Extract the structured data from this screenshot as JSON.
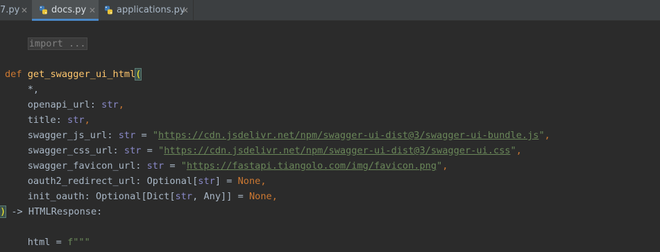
{
  "tabs": [
    {
      "label": "7.py",
      "active": false
    },
    {
      "label": "docs.py",
      "active": true
    },
    {
      "label": "applications.py",
      "active": false
    }
  ],
  "editor": {
    "fold": "import ...",
    "def_kw": "def",
    "fn_name": "get_swagger_ui_html",
    "open_paren": "(",
    "star": "*,",
    "params": [
      {
        "name": "openapi_url",
        "type": "str"
      },
      {
        "name": "title",
        "type": "str"
      },
      {
        "name": "swagger_js_url",
        "type": "str",
        "url": "https://cdn.jsdelivr.net/npm/swagger-ui-dist@3/swagger-ui-bundle.js"
      },
      {
        "name": "swagger_css_url",
        "type": "str",
        "url": "https://cdn.jsdelivr.net/npm/swagger-ui-dist@3/swagger-ui.css"
      },
      {
        "name": "swagger_favicon_url",
        "type": "str",
        "url": "https://fastapi.tiangolo.com/img/favicon.png"
      },
      {
        "name": "oauth2_redirect_url",
        "type_prefix": "Optional[",
        "type": "str",
        "type_suffix": "]",
        "default": "None"
      },
      {
        "name": "init_oauth",
        "type_prefix": "Optional[Dict[",
        "type": "str",
        "type_suffix": ", Any]]",
        "default": "None"
      }
    ],
    "close_paren": ")",
    "return_text": " -> HTMLResponse:",
    "html_var": "html",
    "html_assign": " = ",
    "fstring": "f\"\"\""
  }
}
